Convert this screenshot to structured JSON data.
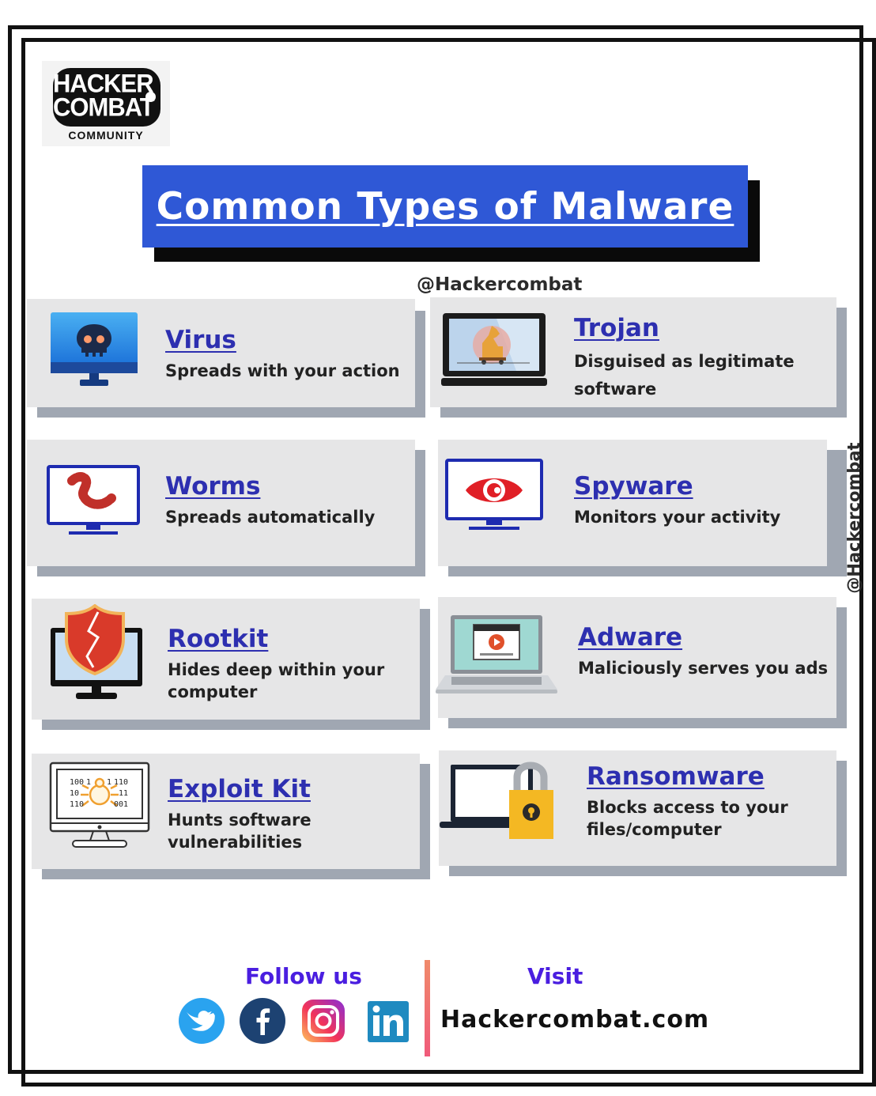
{
  "logo": {
    "line1": "HACKER",
    "line2": "COMBAT",
    "sub": "COMMUNITY"
  },
  "title": "Common Types of Malware",
  "handle_top": "@Hackercombat",
  "handle_side": "@Hackercombat",
  "cards": [
    {
      "title": "Virus",
      "desc": "Spreads with your action",
      "icon": "monitor-skull-icon"
    },
    {
      "title": "Trojan",
      "desc_lines": [
        "Disguised as legitimate",
        "software"
      ],
      "icon": "monitor-trojan-horse-icon"
    },
    {
      "title": "Worms",
      "desc": "Spreads automatically",
      "icon": "monitor-worm-icon"
    },
    {
      "title": "Spyware",
      "desc": "Monitors your activity",
      "icon": "monitor-eye-icon"
    },
    {
      "title": "Rootkit",
      "desc_lines": [
        "Hides deep within your",
        "computer"
      ],
      "icon": "monitor-shield-icon"
    },
    {
      "title": "Adware",
      "desc": "Maliciously serves you ads",
      "icon": "laptop-ad-icon"
    },
    {
      "title": "Exploit Kit",
      "desc_lines": [
        "Hunts software",
        "vulnerabilities"
      ],
      "icon": "monitor-bug-icon",
      "icon_text": [
        "100",
        "1",
        "1",
        "110",
        "10",
        "11",
        "110",
        "001"
      ]
    },
    {
      "title": "Ransomware",
      "desc_lines": [
        "Blocks access to your",
        "files/computer"
      ],
      "icon": "laptop-padlock-icon"
    }
  ],
  "footer": {
    "follow": "Follow us",
    "visit": "Visit",
    "site": "Hackercombat.com",
    "social": [
      "twitter-icon",
      "facebook-icon",
      "instagram-icon",
      "linkedin-icon"
    ]
  },
  "colors": {
    "title_bg": "#2f58d6",
    "card_title": "#2d2fb0",
    "card_bg": "#e6e6e7",
    "card_shadow": "#a0a7b2",
    "footer_accent": "#4a1ee0"
  }
}
